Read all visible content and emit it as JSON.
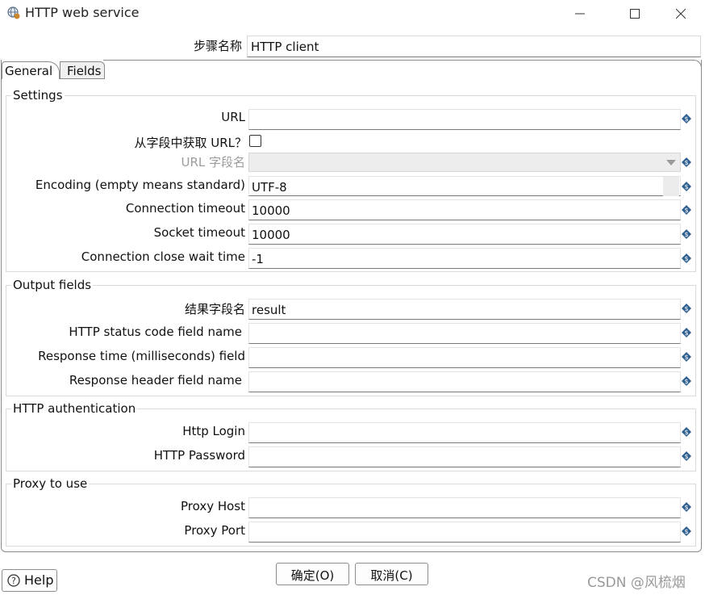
{
  "window": {
    "title": "HTTP web service",
    "icon": "globe-icon"
  },
  "step_name": {
    "label": "步骤名称",
    "value": "HTTP client"
  },
  "tabs": [
    {
      "label": "General",
      "selected": true
    },
    {
      "label": "Fields",
      "selected": false
    }
  ],
  "settings": {
    "title": "Settings",
    "url_label": "URL",
    "url_value": "",
    "url_from_field_label": "从字段中获取 URL？",
    "url_from_field_checked": false,
    "url_field_name_label": "URL 字段名",
    "url_field_name_value": "",
    "encoding_label": "Encoding (empty means standard)",
    "encoding_value": "UTF-8",
    "connection_timeout_label": "Connection timeout",
    "connection_timeout_value": "10000",
    "socket_timeout_label": "Socket timeout",
    "socket_timeout_value": "10000",
    "close_wait_label": "Connection close wait time",
    "close_wait_value": "-1"
  },
  "output_fields": {
    "title": "Output fields",
    "result_label": "结果字段名",
    "result_value": "result",
    "status_code_label": "HTTP status code field name",
    "status_code_value": "",
    "response_time_label": "Response time (milliseconds) field",
    "response_time_value": "",
    "response_header_label": "Response header field name",
    "response_header_value": ""
  },
  "http_auth": {
    "title": "HTTP authentication",
    "login_label": "Http Login",
    "login_value": "",
    "password_label": "HTTP Password",
    "password_value": ""
  },
  "proxy": {
    "title": "Proxy to use",
    "host_label": "Proxy Host",
    "host_value": "",
    "port_label": "Proxy Port",
    "port_value": ""
  },
  "buttons": {
    "help": "Help",
    "ok": "确定(O)",
    "cancel": "取消(C)"
  },
  "watermark": "CSDN @风梳烟",
  "colors": {
    "variable_icon": "#2f5f8f",
    "border": "#8a8a8a"
  }
}
